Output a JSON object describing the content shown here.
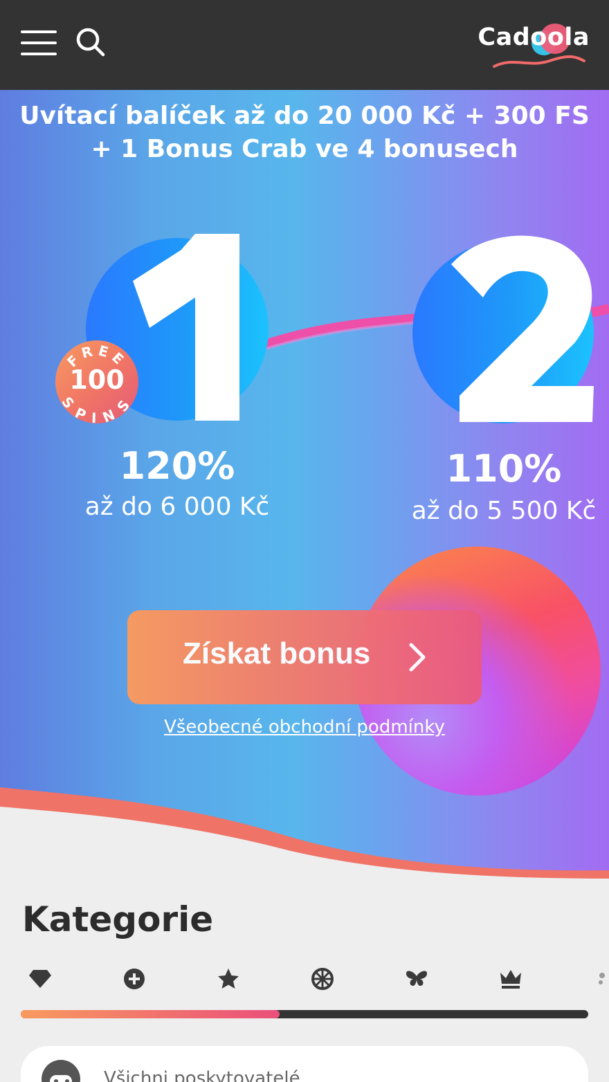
{
  "header": {
    "menu_icon": "hamburger-menu-icon",
    "search_icon": "search-icon",
    "logo_text": "Cadoola"
  },
  "hero": {
    "title_line1": "Uvítací balíček až do 20 000 Kč + 300 FS",
    "title_line2": "+ 1 Bonus Crab ve 4 bonusech",
    "steps": [
      {
        "number": "1",
        "percent": "120%",
        "upto": "až do 6 000 Kč"
      },
      {
        "number": "2",
        "percent": "110%",
        "upto": "až do 5 500 Kč"
      }
    ],
    "badge": {
      "top": "FREE",
      "number": "100",
      "bottom": "SPINS"
    },
    "cta_label": "Získat bonus",
    "terms_link": "Všeobecné obchodní podmínky"
  },
  "categories": {
    "title": "Kategorie",
    "icons": [
      "diamond-icon",
      "plus-circle-icon",
      "star-icon",
      "wheel-icon",
      "butterfly-icon",
      "crown-icon"
    ],
    "scroll_progress": 0.456,
    "provider_label": "Všichni poskytovatelé"
  },
  "colors": {
    "header_bg": "#333333",
    "cta_start": "#fb9a5c",
    "cta_end": "#e95a80",
    "circle_blue": "#1e9af9",
    "wave": "#f07367"
  }
}
